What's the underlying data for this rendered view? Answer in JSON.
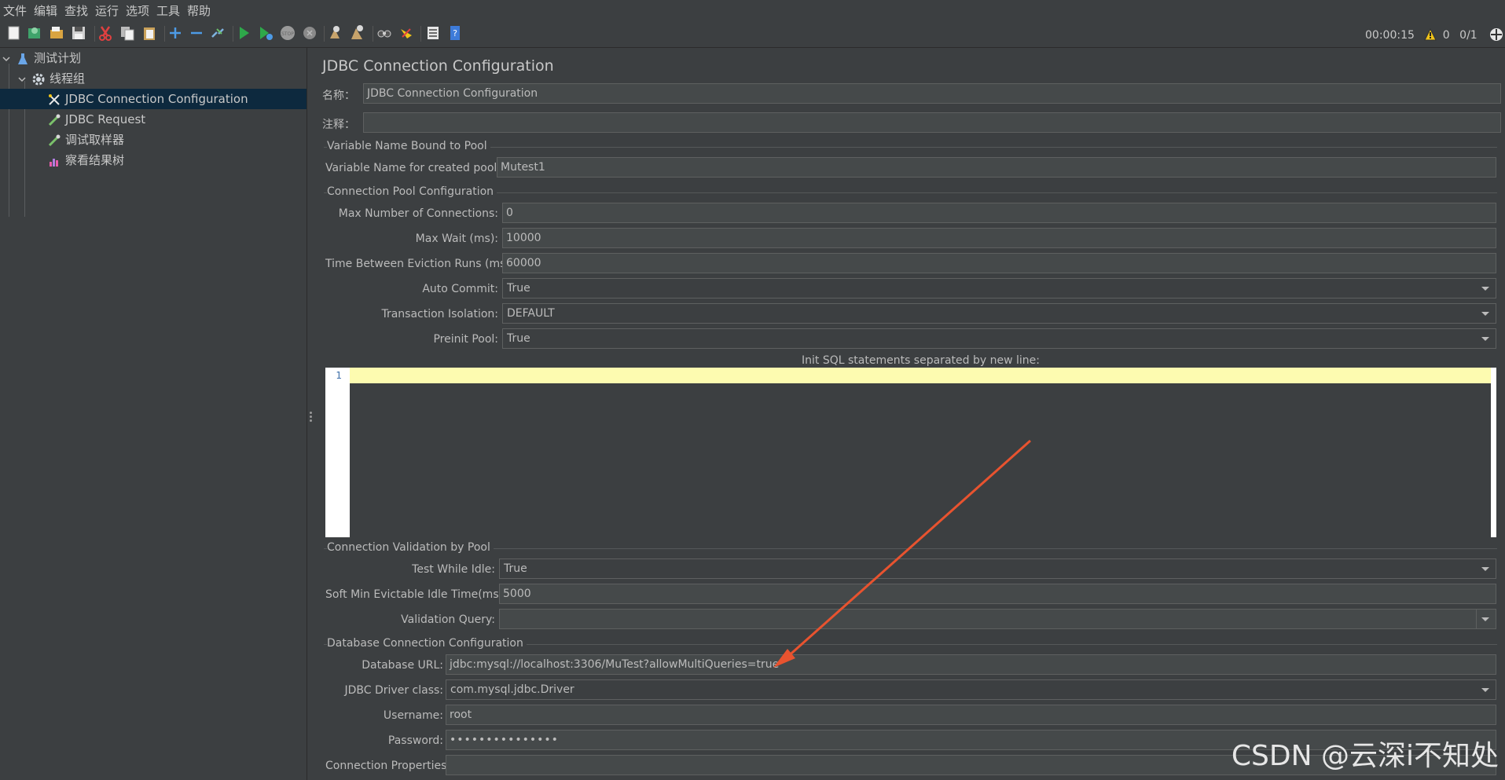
{
  "menu": [
    "文件",
    "编辑",
    "查找",
    "运行",
    "选项",
    "工具",
    "帮助"
  ],
  "toolbar": {
    "icons": [
      "new-icon",
      "templates-icon",
      "open-icon",
      "save-icon",
      "cut-icon",
      "copy-icon",
      "paste-icon",
      "expand-icon",
      "collapse-icon",
      "toggle-icon",
      "start-icon",
      "start-no-pause-icon",
      "stop-icon",
      "shutdown-icon",
      "clear-icon",
      "clear-all-icon",
      "search-icon",
      "reset-search-icon",
      "function-helper-icon",
      "help-icon"
    ],
    "timer": "00:00:15",
    "warnings": "0",
    "threads": "0/1"
  },
  "tree": {
    "plan": "测试计划",
    "group": "线程组",
    "items": [
      {
        "label": "JDBC Connection Configuration",
        "icon": "config-icon",
        "selected": true
      },
      {
        "label": "JDBC Request",
        "icon": "sampler-icon"
      },
      {
        "label": "调试取样器",
        "icon": "sampler-icon"
      },
      {
        "label": "察看结果树",
        "icon": "listener-icon"
      }
    ]
  },
  "panel": {
    "title": "JDBC Connection Configuration",
    "name_label": "名称：",
    "name_value": "JDBC Connection Configuration",
    "comment_label": "注释：",
    "comment_value": ""
  },
  "sections": {
    "variable": {
      "title": "Variable Name Bound to Pool",
      "pool_label": "Variable Name for created pool:",
      "pool_value": "Mutest1"
    },
    "pool": {
      "title": "Connection Pool Configuration",
      "max_conn_label": "Max Number of Connections:",
      "max_conn_value": "0",
      "max_wait_label": "Max Wait (ms):",
      "max_wait_value": "10000",
      "eviction_label": "Time Between Eviction Runs (ms):",
      "eviction_value": "60000",
      "autocommit_label": "Auto Commit:",
      "autocommit_value": "True",
      "isolation_label": "Transaction Isolation:",
      "isolation_value": "DEFAULT",
      "preinit_label": "Preinit Pool:",
      "preinit_value": "True",
      "init_sql_label": "Init SQL statements separated by new line:",
      "init_sql_line": "1"
    },
    "validation": {
      "title": "Connection Validation by Pool",
      "test_idle_label": "Test While Idle:",
      "test_idle_value": "True",
      "soft_min_label": "Soft Min Evictable Idle Time(ms):",
      "soft_min_value": "5000",
      "query_label": "Validation Query:",
      "query_value": ""
    },
    "database": {
      "title": "Database Connection Configuration",
      "url_label": "Database URL:",
      "url_value": "jdbc:mysql://localhost:3306/MuTest?allowMultiQueries=true",
      "driver_label": "JDBC Driver class:",
      "driver_value": "com.mysql.jdbc.Driver",
      "user_label": "Username:",
      "user_value": "root",
      "password_label": "Password:",
      "password_value": "•••••••••••••••",
      "props_label": "Connection Properties:",
      "props_value": ""
    }
  },
  "watermark": "CSDN @云深i不知处",
  "colors": {
    "background": "#3c3f41",
    "selection": "#0d293e",
    "annotation_arrow": "#e8532f",
    "editor_current_line": "#fdfbb0"
  }
}
